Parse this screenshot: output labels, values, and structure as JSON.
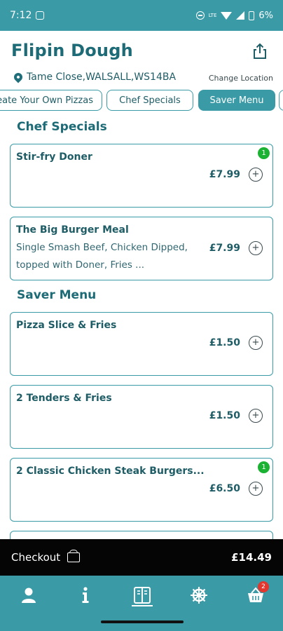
{
  "status": {
    "time": "7:12",
    "battery": "6%",
    "network": "LTE"
  },
  "header": {
    "title": "Flipin Dough",
    "location": "Tame Close,WALSALL,WS14BA",
    "change_location": "Change Location"
  },
  "tabs": [
    {
      "label": "Create Your Own Pizzas",
      "active": false
    },
    {
      "label": "Chef Specials",
      "active": false
    },
    {
      "label": "Saver Menu",
      "active": true
    },
    {
      "label": "",
      "active": false
    }
  ],
  "sections": [
    {
      "title": "Chef Specials",
      "items": [
        {
          "name": "Stir-fry Doner",
          "desc": "",
          "price": "£7.99",
          "qty": "1"
        },
        {
          "name": "The Big Burger Meal",
          "desc": "Single Smash Beef, Chicken Dipped, topped with Doner, Fries ...",
          "price": "£7.99",
          "qty": ""
        }
      ]
    },
    {
      "title": "Saver Menu",
      "items": [
        {
          "name": "Pizza Slice & Fries",
          "desc": "",
          "price": "£1.50",
          "qty": ""
        },
        {
          "name": "2 Tenders & Fries",
          "desc": "",
          "price": "£1.50",
          "qty": ""
        },
        {
          "name": "2 Classic Chicken Steak Burgers...",
          "desc": "",
          "price": "£6.50",
          "qty": "1"
        }
      ]
    }
  ],
  "checkout": {
    "label": "Checkout",
    "total": "£14.49"
  },
  "nav": {
    "cart_badge": "2",
    "items": [
      "profile-icon",
      "info-icon",
      "menu-icon",
      "settings-icon",
      "basket-icon"
    ]
  },
  "colors": {
    "primary": "#3a9aa6",
    "text": "#1f5d66",
    "badge_green": "#1bb233",
    "cart_badge": "#e1372f"
  }
}
